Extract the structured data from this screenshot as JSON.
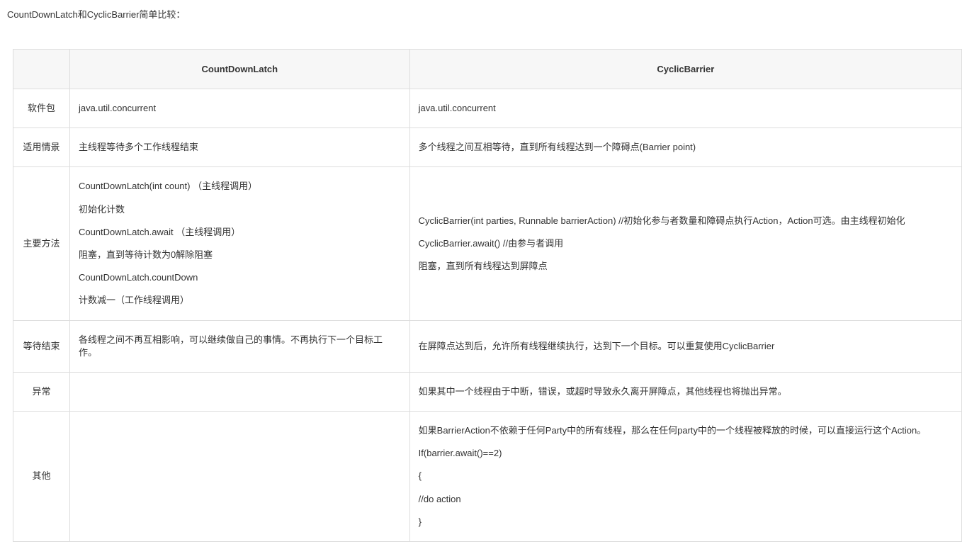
{
  "title": "CountDownLatch和CyclicBarrier简单比较：",
  "headers": {
    "blank": "",
    "col1": "CountDownLatch",
    "col2": "CyclicBarrier"
  },
  "rows": {
    "package": {
      "label": "软件包",
      "col1": "java.util.concurrent",
      "col2": "java.util.concurrent"
    },
    "scenario": {
      "label": "适用情景",
      "col1": "主线程等待多个工作线程结束",
      "col2": "多个线程之间互相等待，直到所有线程达到一个障碍点(Barrier point)"
    },
    "methods": {
      "label": "主要方法",
      "col1_lines": {
        "l1": "CountDownLatch(int count) （主线程调用）",
        "l2": "初始化计数",
        "l3": "CountDownLatch.await （主线程调用）",
        "l4": "阻塞，直到等待计数为0解除阻塞",
        "l5": "CountDownLatch.countDown",
        "l6": "计数减一（工作线程调用）"
      },
      "col2_lines": {
        "l1": "CyclicBarrier(int parties, Runnable barrierAction) //初始化参与者数量和障碍点执行Action，Action可选。由主线程初始化",
        "l2": "CyclicBarrier.await() //由参与者调用",
        "l3": "阻塞，直到所有线程达到屏障点"
      }
    },
    "waitEnd": {
      "label": "等待结束",
      "col1": "各线程之间不再互相影响，可以继续做自己的事情。不再执行下一个目标工作。",
      "col2": "在屏障点达到后，允许所有线程继续执行，达到下一个目标。可以重复使用CyclicBarrier"
    },
    "exception": {
      "label": "异常",
      "col1": "",
      "col2": "如果其中一个线程由于中断，错误，或超时导致永久离开屏障点，其他线程也将抛出异常。"
    },
    "other": {
      "label": "其他",
      "col1": "",
      "col2_lines": {
        "l1": "如果BarrierAction不依赖于任何Party中的所有线程，那么在任何party中的一个线程被释放的时候，可以直接运行这个Action。",
        "l2": "If(barrier.await()==2)",
        "l3": "{",
        "l4": "//do action",
        "l5": "}"
      }
    }
  }
}
